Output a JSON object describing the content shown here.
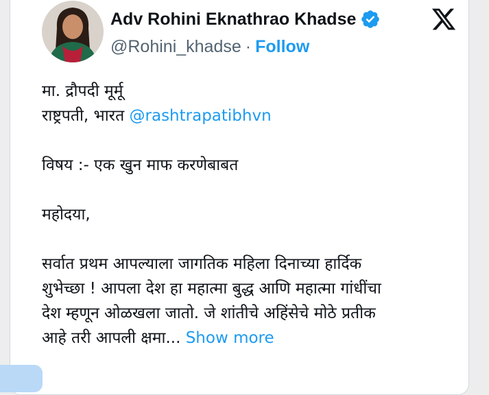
{
  "author": {
    "name": "Adv Rohini Eknathrao Khadse",
    "handle": "@Rohini_khadse",
    "separator": "·",
    "follow_label": "Follow",
    "avatar_icon": "avatar-photo",
    "verified_icon": "verified-badge-icon"
  },
  "platform": {
    "logo_icon": "x-logo-icon"
  },
  "colors": {
    "accent": "#1d9bf0",
    "text": "#0f1419",
    "secondary": "#536471"
  },
  "post": {
    "line1": "मा. द्रौपदी मूर्मू",
    "line2_prefix": "राष्ट्रपती, भारत ",
    "line2_mention": "@rashtrapatibhvn",
    "line3": "विषय :- एक खुन माफ करणेबाबत",
    "line4": "महोदया,",
    "line5": "सर्वात प्रथम आपल्याला जागतिक महिला दिनाच्या हार्दिक",
    "line6": "शुभेच्छा ! आपला देश हा महात्मा बुद्ध आणि महात्मा गांधींचा",
    "line7": "देश म्हणून ओळखला जातो. जे शांतीचे अहिंसेचे मोठे प्रतीक",
    "line8": "आहे तरी आपली क्षमा... ",
    "show_more": "Show more"
  }
}
